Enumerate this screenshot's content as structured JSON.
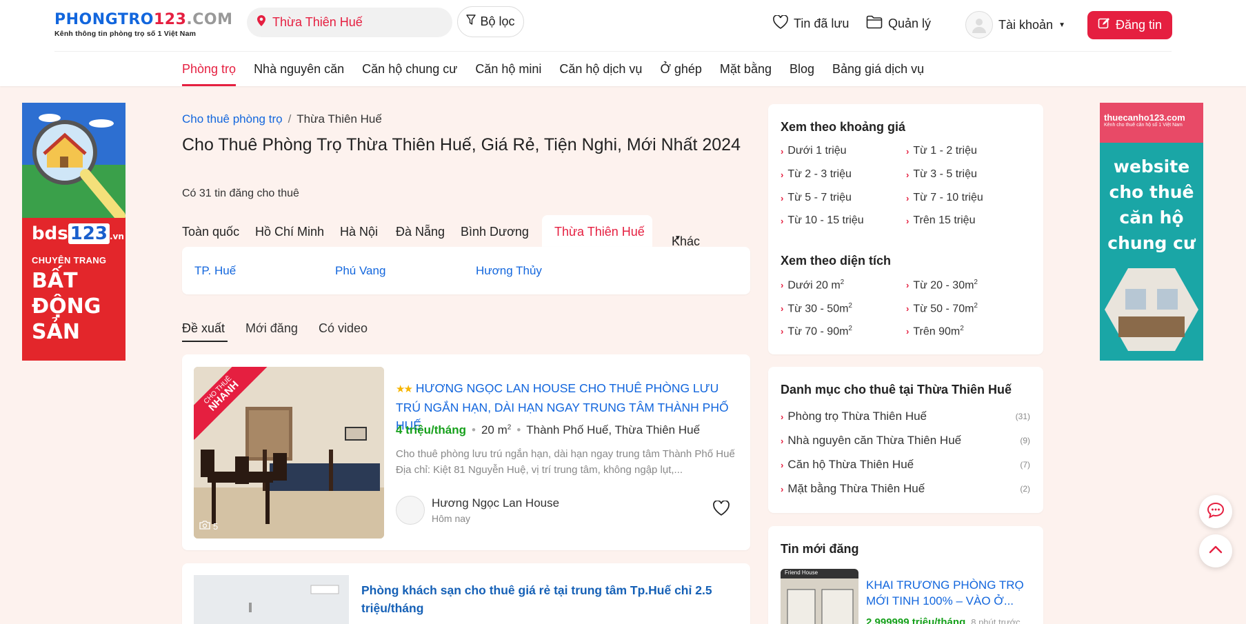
{
  "header": {
    "logo_main": "PHONGTRO",
    "logo_num": "123",
    "logo_com": ".COM",
    "slogan": "Kênh thông tin phòng trọ số 1 Việt Nam",
    "search_location": "Thừa Thiên Huế",
    "filter_label": "Bộ lọc",
    "saved_label": "Tin đã lưu",
    "manage_label": "Quản lý",
    "account_label": "Tài khoản",
    "post_label": "Đăng tin"
  },
  "nav": [
    "Phòng trọ",
    "Nhà nguyên căn",
    "Căn hộ chung cư",
    "Căn hộ mini",
    "Căn hộ dịch vụ",
    "Ở ghép",
    "Mặt bằng",
    "Blog",
    "Bảng giá dịch vụ"
  ],
  "ads": {
    "left_brand": "bds",
    "left_brand_num": "123",
    "left_brand_tld": ".vn",
    "left_tag": "CHUYÊN TRANG",
    "left_headline": [
      "BẤT",
      "ĐỘNG",
      "SẢN"
    ],
    "right_brand": "thuecanho123.com",
    "right_slogan": "Kênh cho thuê căn hộ số 1 Việt Nam",
    "right_headline": [
      "website",
      "cho thuê",
      "căn hộ",
      "chung cư"
    ]
  },
  "breadcrumb": {
    "root": "Cho thuê phòng trọ",
    "current": "Thừa Thiên Huế"
  },
  "page_title": "Cho Thuê Phòng Trọ Thừa Thiên Huế, Giá Rẻ, Tiện Nghi, Mới Nhất 2024",
  "listing_count": "Có 31 tin đăng cho thuê",
  "region_tabs": [
    "Toàn quốc",
    "Hồ Chí Minh",
    "Hà Nội",
    "Đà Nẵng",
    "Bình Dương",
    "Thừa Thiên Huế",
    "Khác"
  ],
  "sub_regions": [
    "TP. Huế",
    "Phú Vang",
    "Hương Thủy"
  ],
  "sort_tabs": [
    "Đề xuất",
    "Mới đăng",
    "Có video"
  ],
  "listings": [
    {
      "badge_small": "CHO THUÊ",
      "badge_big": "NHANH",
      "photo_count": "5",
      "stars": "★★",
      "title": "HƯƠNG NGỌC LAN HOUSE CHO THUÊ PHÒNG LƯU TRÚ NGẮN HẠN, DÀI HẠN NGAY TRUNG TÂM THÀNH PHỐ HUẾ",
      "price": "4 triệu/tháng",
      "area": "20 m",
      "area_sup": "2",
      "location": "Thành Phố Huế, Thừa Thiên Huế",
      "description": "Cho thuê phòng lưu trú ngắn hạn, dài hạn ngay trung tâm Thành Phố Huế Địa chỉ: Kiệt 81 Nguyễn Huệ, vị trí trung tâm, không ngập lụt,...",
      "author": "Hương Ngọc Lan House",
      "time": "Hôm nay"
    },
    {
      "title": "Phòng khách sạn cho thuê giá rẻ tại trung tâm Tp.Huế chỉ 2.5 triệu/tháng"
    }
  ],
  "sidebar": {
    "price_title": "Xem theo khoảng giá",
    "price_ranges": [
      "Dưới 1 triệu",
      "Từ 1 - 2 triệu",
      "Từ 2 - 3 triệu",
      "Từ 3 - 5 triệu",
      "Từ 5 - 7 triệu",
      "Từ 7 - 10 triệu",
      "Từ 10 - 15 triệu",
      "Trên 15 triệu"
    ],
    "area_title": "Xem theo diện tích",
    "area_ranges": [
      "Dưới 20 m",
      "Từ 20 - 30m",
      "Từ 30 - 50m",
      "Từ 50 - 70m",
      "Từ 70 - 90m",
      "Trên 90m"
    ],
    "area_sup": "2",
    "category_title": "Danh mục cho thuê tại Thừa Thiên Huế",
    "categories": [
      {
        "label": "Phòng trọ Thừa Thiên Huế",
        "count": "(31)"
      },
      {
        "label": "Nhà nguyên căn Thừa Thiên Huế",
        "count": "(9)"
      },
      {
        "label": "Căn hộ Thừa Thiên Huế",
        "count": "(7)"
      },
      {
        "label": "Mặt bằng Thừa Thiên Huế",
        "count": "(2)"
      }
    ],
    "new_title": "Tin mới đăng",
    "new_post": {
      "thumb_label": "Friend House",
      "title": "KHAI TRƯƠNG PHÒNG TRỌ MỚI TINH 100% – VÀO Ở...",
      "price": "2.999999 triệu/tháng",
      "ago": "8 phút trước"
    }
  },
  "colors": {
    "brand_red": "#e51f40",
    "link_blue": "#1266dd",
    "price_green": "#16a01b",
    "page_bg": "#fdf2ee"
  }
}
